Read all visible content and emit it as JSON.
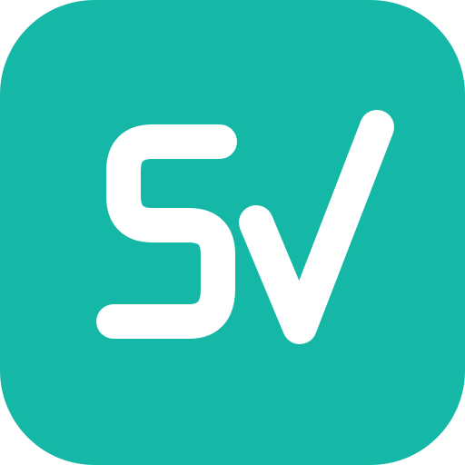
{
  "logo": {
    "lettering": "SV",
    "icon": "sv-app-logo-icon"
  },
  "colors": {
    "background": "#15b8a6",
    "glyph": "#ffffff"
  }
}
